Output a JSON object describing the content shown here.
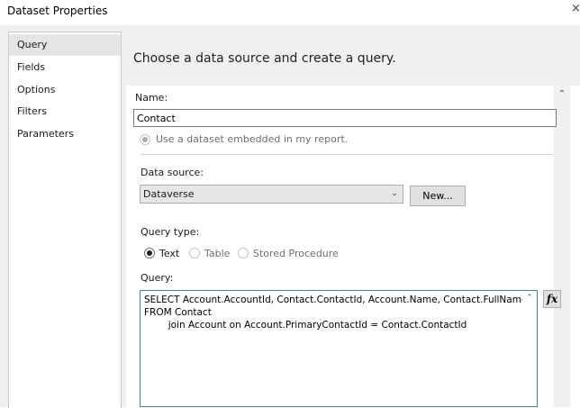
{
  "window": {
    "title": "Dataset Properties",
    "close_glyph": "×"
  },
  "nav": {
    "items": [
      {
        "label": "Query",
        "selected": true
      },
      {
        "label": "Fields"
      },
      {
        "label": "Options"
      },
      {
        "label": "Filters"
      },
      {
        "label": "Parameters"
      }
    ]
  },
  "header": {
    "text": "Choose a data source and create a query."
  },
  "form": {
    "name_label": "Name:",
    "name_value": "Contact",
    "embedded_option_label": "Use a dataset embedded in my report.",
    "data_source_label": "Data source:",
    "data_source_value": "Dataverse",
    "new_button_label": "New...",
    "query_type_label": "Query type:",
    "query_types": [
      {
        "label": "Text",
        "checked": true,
        "enabled": true
      },
      {
        "label": "Table",
        "checked": false,
        "enabled": false
      },
      {
        "label": "Stored Procedure",
        "checked": false,
        "enabled": false
      }
    ],
    "query_label": "Query:",
    "query_text": "SELECT Account.AccountId, Contact.ContactId, Account.Name, Contact.FullName\nFROM Contact\n        join Account on Account.PrimaryContactId = Contact.ContactId",
    "fx_button_label": "fx"
  },
  "icons": {
    "combo_arrow": "chevron-down-icon",
    "scroll_up": "chevron-up-icon",
    "close": "close-icon"
  }
}
